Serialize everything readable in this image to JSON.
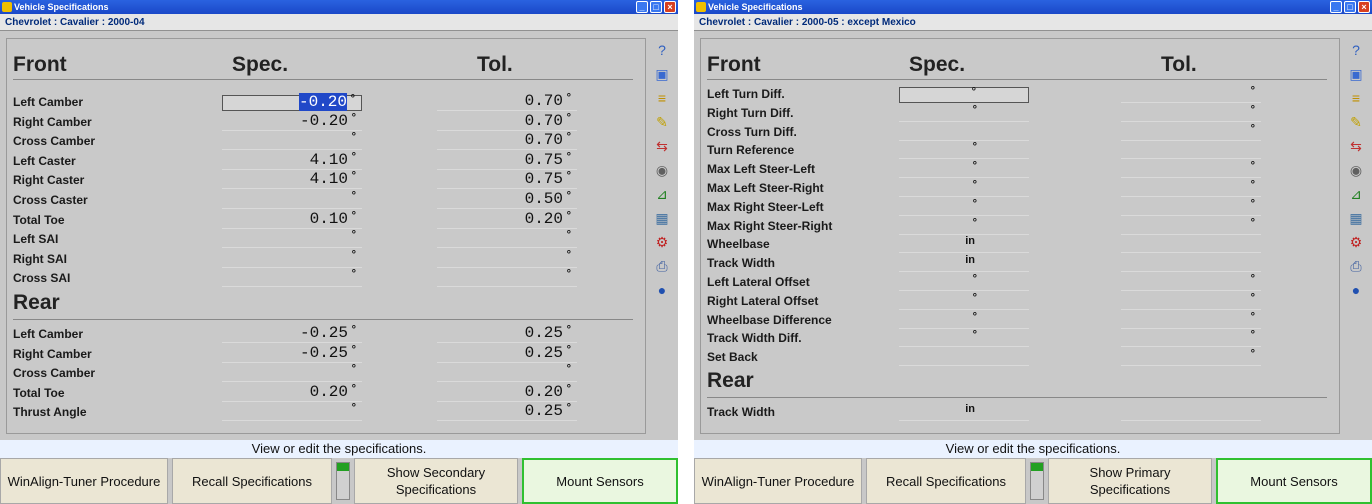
{
  "windows": [
    {
      "title": "Vehicle Specifications",
      "subtitle": "Chevrolet : Cavalier : 2000-04",
      "headers": {
        "front": "Front",
        "spec": "Spec.",
        "tol": "Tol.",
        "rear": "Rear"
      },
      "front_rows": [
        {
          "label": "Left Camber",
          "spec": "-0.20",
          "tol": "0.70",
          "selected": true
        },
        {
          "label": "Right Camber",
          "spec": "-0.20",
          "tol": "0.70"
        },
        {
          "label": "Cross Camber",
          "spec": "",
          "tol": "0.70"
        },
        {
          "label": "Left Caster",
          "spec": "4.10",
          "tol": "0.75"
        },
        {
          "label": "Right Caster",
          "spec": "4.10",
          "tol": "0.75"
        },
        {
          "label": "Cross Caster",
          "spec": "",
          "tol": "0.50"
        },
        {
          "label": "Total Toe",
          "spec": "0.10",
          "tol": "0.20"
        },
        {
          "label": "Left SAI",
          "spec": "",
          "tol": ""
        },
        {
          "label": "Right SAI",
          "spec": "",
          "tol": ""
        },
        {
          "label": "Cross SAI",
          "spec": "",
          "tol": ""
        }
      ],
      "rear_rows": [
        {
          "label": "Left Camber",
          "spec": "-0.25",
          "tol": "0.25"
        },
        {
          "label": "Right Camber",
          "spec": "-0.25",
          "tol": "0.25"
        },
        {
          "label": "Cross Camber",
          "spec": "",
          "tol": ""
        },
        {
          "label": "Total Toe",
          "spec": "0.20",
          "tol": "0.20"
        },
        {
          "label": "Thrust Angle",
          "spec": "",
          "tol": "0.25"
        }
      ],
      "status": "View or edit the specifications.",
      "buttons": [
        "WinAlign-Tuner Procedure",
        "Recall Specifications",
        "Show Secondary Specifications",
        "Mount Sensors"
      ]
    },
    {
      "title": "Vehicle Specifications",
      "subtitle": "Chevrolet : Cavalier : 2000-05 : except Mexico",
      "headers": {
        "front": "Front",
        "spec": "Spec.",
        "tol": "Tol.",
        "rear": "Rear"
      },
      "front_rows": [
        {
          "label": "Left Turn Diff.",
          "unit_spec": "°",
          "unit_tol": "°",
          "selected": true
        },
        {
          "label": "Right Turn Diff.",
          "unit_spec": "°",
          "unit_tol": "°"
        },
        {
          "label": "Cross Turn Diff.",
          "unit_spec": "",
          "unit_tol": "°"
        },
        {
          "label": "Turn Reference",
          "unit_spec": "°",
          "unit_tol": ""
        },
        {
          "label": "Max Left Steer-Left",
          "unit_spec": "°",
          "unit_tol": "°"
        },
        {
          "label": "Max Left Steer-Right",
          "unit_spec": "°",
          "unit_tol": "°"
        },
        {
          "label": "Max Right Steer-Left",
          "unit_spec": "°",
          "unit_tol": "°"
        },
        {
          "label": "Max Right Steer-Right",
          "unit_spec": "°",
          "unit_tol": "°"
        },
        {
          "label": "Wheelbase",
          "unit_spec": "in",
          "unit_tol": ""
        },
        {
          "label": "Track Width",
          "unit_spec": "in",
          "unit_tol": ""
        },
        {
          "label": "Left Lateral Offset",
          "unit_spec": "°",
          "unit_tol": "°"
        },
        {
          "label": "Right Lateral Offset",
          "unit_spec": "°",
          "unit_tol": "°"
        },
        {
          "label": "Wheelbase Difference",
          "unit_spec": "°",
          "unit_tol": "°"
        },
        {
          "label": "Track Width Diff.",
          "unit_spec": "°",
          "unit_tol": "°"
        },
        {
          "label": "Set Back",
          "unit_spec": "",
          "unit_tol": "°"
        }
      ],
      "rear_rows": [
        {
          "label": "Track Width",
          "unit_spec": "in",
          "unit_tol": ""
        }
      ],
      "status": "View or edit the specifications.",
      "buttons": [
        "WinAlign-Tuner Procedure",
        "Recall Specifications",
        "Show Primary Specifications",
        "Mount Sensors"
      ]
    }
  ],
  "icons": [
    "help-icon",
    "vehicle-icon",
    "spec-icon",
    "pencil-icon",
    "toe-icon",
    "sensor-icon",
    "camber-icon",
    "calculator-icon",
    "adjust-icon",
    "print-icon",
    "globe-icon"
  ]
}
